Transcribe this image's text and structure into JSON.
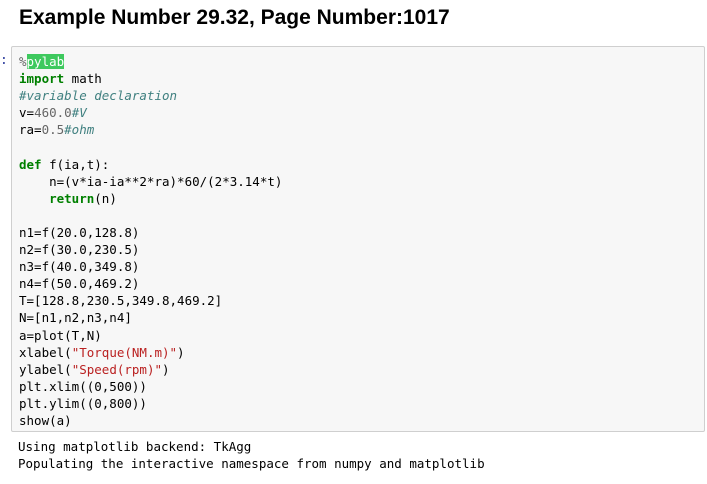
{
  "heading": "Example Number 29.32, Page Number:1017",
  "prompt": ":",
  "code": {
    "magic_pct": "%",
    "magic_word": "pylab",
    "import_kw": "import",
    "import_mod": " math",
    "comment_decl": "#variable declaration",
    "v_assign": "v=",
    "v_val": "460.0",
    "v_comment": "#V",
    "ra_assign": "ra=",
    "ra_val": "0.5",
    "ra_comment": "#ohm",
    "def_kw": "def",
    "def_sig": " f(ia,t):",
    "body_line": "    n=(v*ia-ia**2*ra)*60/(2*3.14*t)",
    "return_indent": "    ",
    "return_kw": "return",
    "return_arg": "(n)",
    "n1": "n1=f(20.0,128.8)",
    "n2": "n2=f(30.0,230.5)",
    "n3": "n3=f(40.0,349.8)",
    "n4": "n4=f(50.0,469.2)",
    "T": "T=[128.8,230.5,349.8,469.2]",
    "N": "N=[n1,n2,n3,n4]",
    "plot": "a=plot(T,N)",
    "xlabel_fn": "xlabel(",
    "xlabel_str": "\"Torque(NM.m)\"",
    "ylabel_fn": "ylabel(",
    "ylabel_str": "\"Speed(rpm)\"",
    "close_paren": ")",
    "xlim": "plt.xlim((0,500))",
    "ylim": "plt.ylim((0,800))",
    "show": "show(a)"
  },
  "output": {
    "line1": "Using matplotlib backend: TkAgg",
    "line2": "Populating the interactive namespace from numpy and matplotlib"
  },
  "colors": {
    "keyword": "#008000",
    "comment": "#408080",
    "string": "#ba2121",
    "cell_background": "#f7f7f7",
    "magic_highlight": "#3ec95e"
  }
}
